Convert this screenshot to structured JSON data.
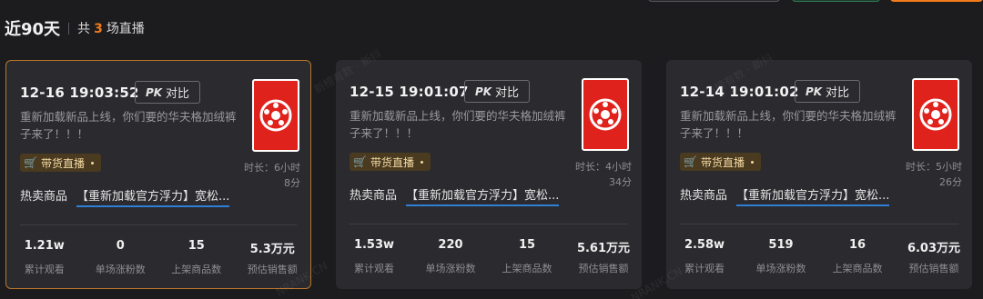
{
  "header": {
    "period": "近90天",
    "count_prefix": "共",
    "count": "3",
    "count_suffix": "场直播"
  },
  "colors": {
    "accent": "#f27a1a",
    "card_bg": "#2b2b2f",
    "active_border": "#b8742b",
    "thumb_red": "#e0221c"
  },
  "watermarks": [
    "新榜有数 · 新抖",
    "新榜有数 · 新抖",
    "NRANK.CN",
    "NRANK.CN"
  ],
  "cards": [
    {
      "time": "12-16 19:03:52",
      "pk_label": "对比",
      "pk_icon": "PK",
      "title": "重新加载新品上线，你们要的华夫格加绒裤子来了！！！",
      "duration_line1": "时长：6小时",
      "duration_line2": "8分",
      "tag": "带货直播",
      "hot_label": "热卖商品",
      "hot_product": "【重新加载官方浮力】宽松...",
      "stats": [
        {
          "value": "1.21w",
          "label": "累计观看"
        },
        {
          "value": "0",
          "label": "单场涨粉数"
        },
        {
          "value": "15",
          "label": "上架商品数"
        },
        {
          "value": "5.3万元",
          "label": "预估销售额"
        }
      ]
    },
    {
      "time": "12-15 19:01:07",
      "pk_label": "对比",
      "pk_icon": "PK",
      "title": "重新加载新品上线，你们要的华夫格加绒裤子来了！！！",
      "duration_line1": "时长：4小时",
      "duration_line2": "34分",
      "tag": "带货直播",
      "hot_label": "热卖商品",
      "hot_product": "【重新加载官方浮力】宽松...",
      "stats": [
        {
          "value": "1.53w",
          "label": "累计观看"
        },
        {
          "value": "220",
          "label": "单场涨粉数"
        },
        {
          "value": "15",
          "label": "上架商品数"
        },
        {
          "value": "5.61万元",
          "label": "预估销售额"
        }
      ]
    },
    {
      "time": "12-14 19:01:02",
      "pk_label": "对比",
      "pk_icon": "PK",
      "title": "重新加载新品上线，你们要的华夫格加绒裤子来了！！！",
      "duration_line1": "时长：5小时",
      "duration_line2": "26分",
      "tag": "带货直播",
      "hot_label": "热卖商品",
      "hot_product": "【重新加载官方浮力】宽松...",
      "stats": [
        {
          "value": "2.58w",
          "label": "累计观看"
        },
        {
          "value": "519",
          "label": "单场涨粉数"
        },
        {
          "value": "16",
          "label": "上架商品数"
        },
        {
          "value": "6.03万元",
          "label": "预估销售额"
        }
      ]
    }
  ]
}
